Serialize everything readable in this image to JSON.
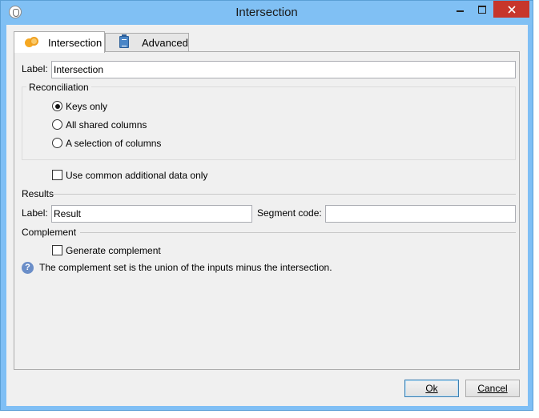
{
  "window": {
    "title": "Intersection"
  },
  "tabs": [
    {
      "label": "Intersection",
      "icon": "intersection-icon",
      "active": true
    },
    {
      "label": "Advanced",
      "icon": "clipboard-icon",
      "active": false
    }
  ],
  "label_field": {
    "label": "Label:",
    "value": "Intersection"
  },
  "reconciliation": {
    "title": "Reconciliation",
    "options": [
      {
        "label": "Keys only",
        "selected": true
      },
      {
        "label": "All shared columns",
        "selected": false
      },
      {
        "label": "A selection of columns",
        "selected": false
      }
    ]
  },
  "common_data": {
    "label": "Use common additional data only",
    "checked": false
  },
  "results": {
    "title": "Results",
    "label_label": "Label:",
    "label_value": "Result",
    "segment_label": "Segment code:",
    "segment_value": ""
  },
  "complement": {
    "title": "Complement",
    "checkbox_label": "Generate complement",
    "checked": false,
    "help_text": "The complement set is the union of the inputs minus the intersection."
  },
  "buttons": {
    "ok": "Ok",
    "cancel": "Cancel"
  },
  "colors": {
    "titlebar": "#80c0f4",
    "close": "#c7362b",
    "background": "#f0f0f0"
  }
}
